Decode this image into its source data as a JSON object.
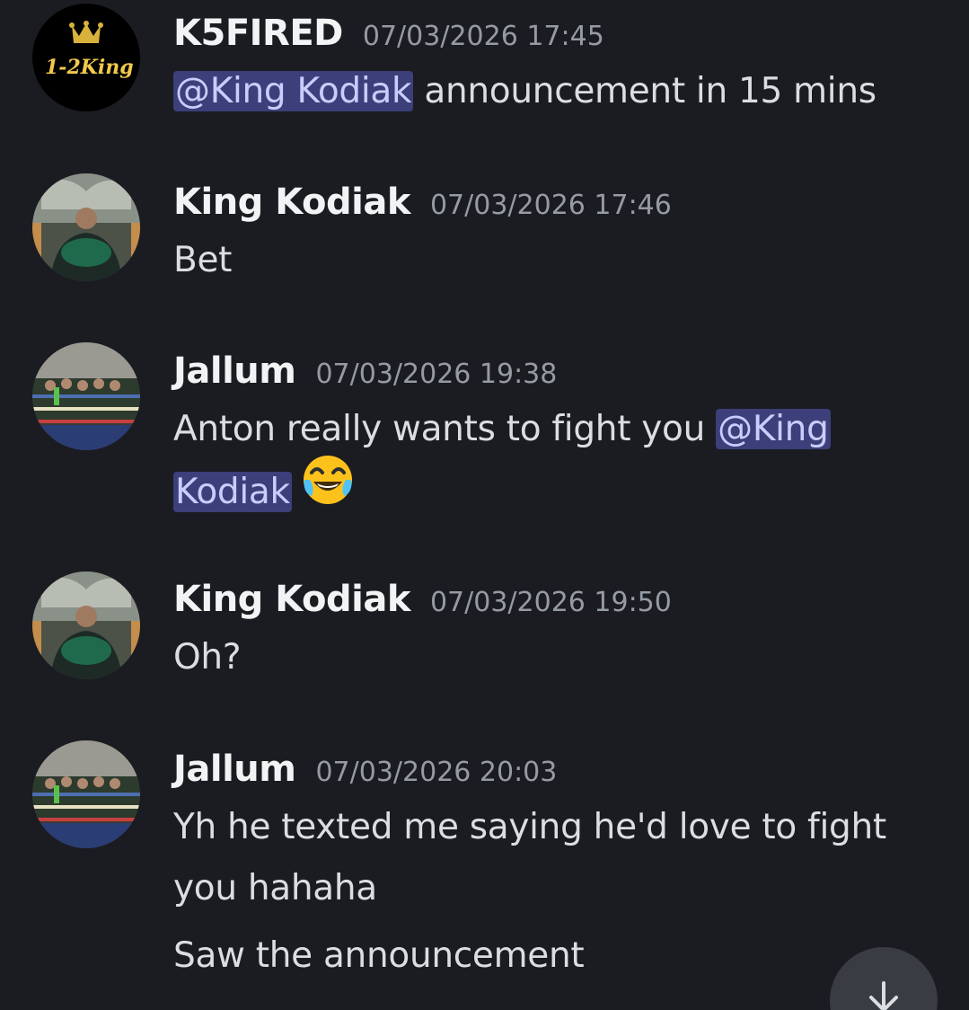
{
  "messages": [
    {
      "username": "K5FIRED",
      "timestamp": "07/03/2026 17:45",
      "avatar_icon": "1-2-king-logo-avatar",
      "avatar_logo_text": "1-2King",
      "mention": "@King Kodiak",
      "text": "announcement in 15 mins"
    },
    {
      "username": "King Kodiak",
      "timestamp": "07/03/2026 17:46",
      "avatar_icon": "user-photo-avatar",
      "text": "Bet"
    },
    {
      "username": "Jallum",
      "timestamp": "07/03/2026 19:38",
      "avatar_icon": "boxing-ring-group-avatar",
      "text_before": "Anton really wants to fight you",
      "mention_part1": "@King",
      "mention_part2": "Kodiak",
      "emoji": "face-with-tears-of-joy-emoji"
    },
    {
      "username": "King Kodiak",
      "timestamp": "07/03/2026 19:50",
      "avatar_icon": "user-photo-avatar",
      "text": "Oh?"
    },
    {
      "username": "Jallum",
      "timestamp": "07/03/2026 20:03",
      "avatar_icon": "boxing-ring-group-avatar",
      "text_line1": "Yh he texted me saying he'd love to fight",
      "text_line2": "you hahaha",
      "followup": "Saw the announcement"
    }
  ],
  "scroll_button": {
    "icon": "arrow-down-icon"
  },
  "colors": {
    "background": "#1b1c21",
    "username": "#f2f3f5",
    "timestamp": "#949ba4",
    "message_text": "#dbdee1",
    "mention_bg": "#3c3f7a",
    "mention_text": "#c9cdfb"
  }
}
